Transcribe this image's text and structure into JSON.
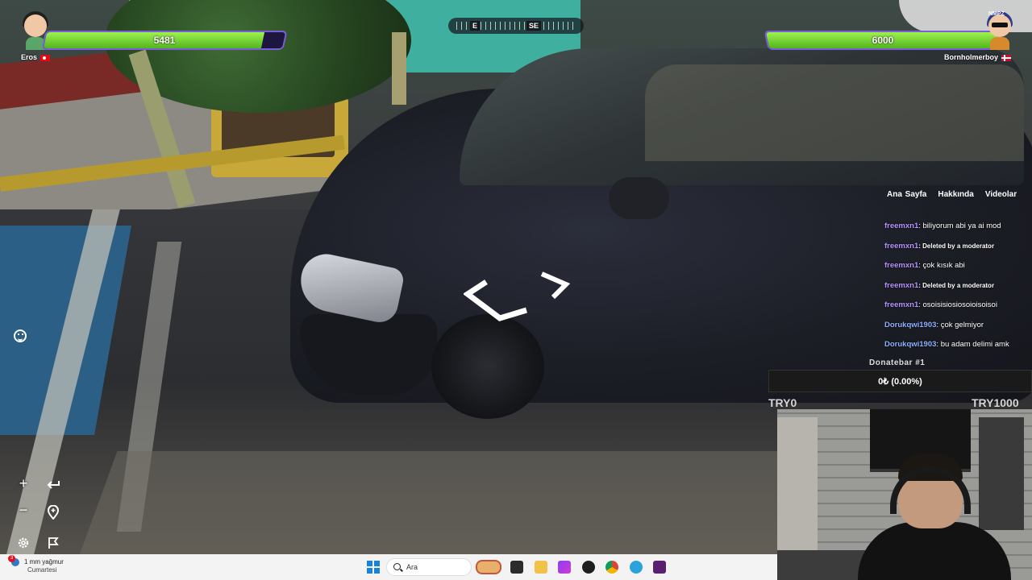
{
  "game": {
    "player_left": {
      "name": "Eros",
      "hp_text": "5481",
      "hp_fraction": 0.9135,
      "flag": "turkey-flag"
    },
    "player_right": {
      "name": "Bornholmerboy",
      "hp_text": "6000",
      "hp_fraction": 1.0,
      "flag": "denmark-flag",
      "avatar_badge": "NMPZ"
    },
    "compass": {
      "left_label": "E",
      "right_label": "SE"
    },
    "controls": [
      "emoji-icon",
      "zoom-in-icon",
      "undo-icon",
      "zoom-out-icon",
      "location-pin-icon",
      "settings-icon",
      "flag-icon"
    ],
    "zoom_in_label": "+",
    "zoom_out_label": "−"
  },
  "chat": {
    "tabs": [
      "Ana Sayfa",
      "Hakkında",
      "Videolar"
    ],
    "messages": [
      {
        "user": "freemxn1",
        "text": ": biliyorum abi ya ai mod",
        "small": false,
        "alt": false
      },
      {
        "user": "freemxn1",
        "text": ": Deleted by a moderator",
        "small": true,
        "alt": false
      },
      {
        "user": "freemxn1",
        "text": ": çok kısık abi",
        "small": false,
        "alt": false
      },
      {
        "user": "freemxn1",
        "text": ": Deleted by a moderator",
        "small": true,
        "alt": false
      },
      {
        "user": "freemxn1",
        "text": ": osoisisiosiosoioisoisoi",
        "small": false,
        "alt": false
      },
      {
        "user": "Dorukqwi1903",
        "text": ": çok gelmiyor",
        "small": false,
        "alt": true
      },
      {
        "user": "Dorukqwi1903",
        "text": ": bu adam delimi amk",
        "small": false,
        "alt": true
      }
    ]
  },
  "donation": {
    "title": "Donatebar #1",
    "value_text": "0₺ (0.00%)",
    "progress_fraction": 0.0,
    "min_label": "TRY0",
    "max_label": "TRY1000"
  },
  "taskbar": {
    "weather_badge": "3",
    "weather_text": "1 mm yağmur",
    "weather_day": "Cumartesi",
    "search_placeholder": "Ara",
    "apps": [
      "start-icon",
      "search-box",
      "widget-icon",
      "terminal-icon",
      "folder-icon",
      "media-icon",
      "obs-icon",
      "chrome-icon",
      "telegram-icon",
      "game-app-icon"
    ]
  },
  "colors": {
    "hp_fill": "#52b51e",
    "hp_border": "#7c5dd8",
    "chat_user": "#b493ff",
    "chat_user_alt": "#8fb0ff",
    "donation_fill": "#6b46e0"
  }
}
